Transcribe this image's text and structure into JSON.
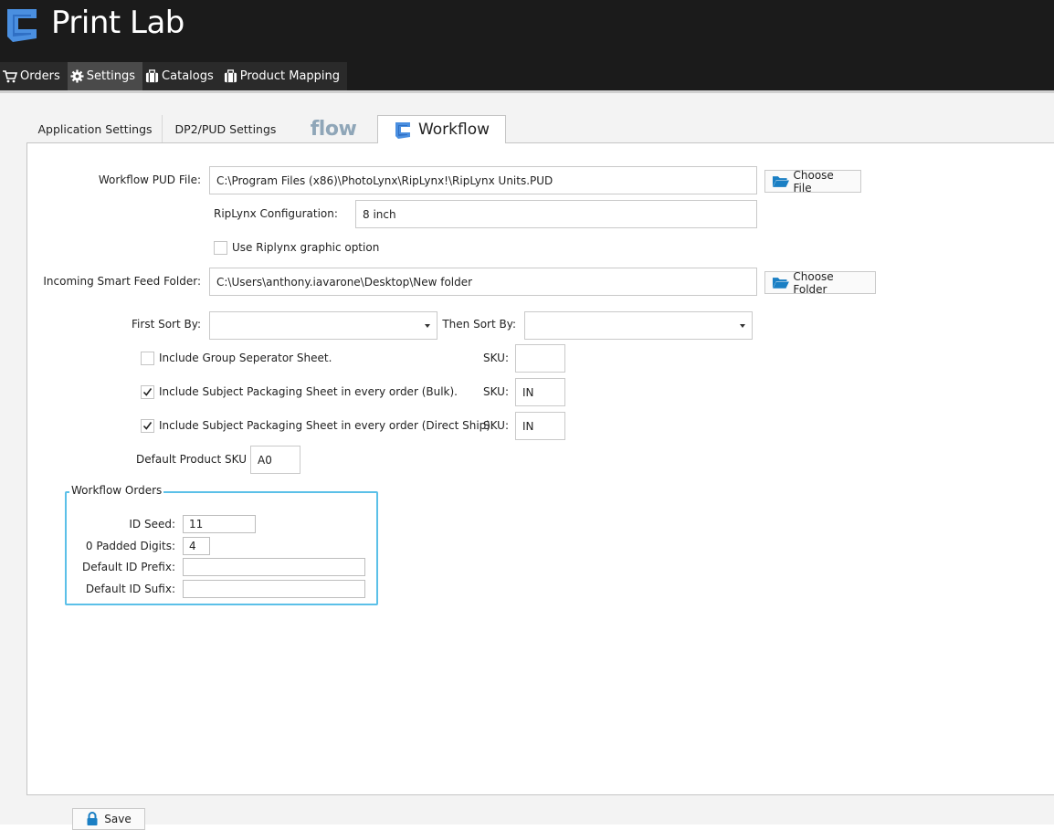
{
  "app": {
    "title": "Print Lab"
  },
  "nav": {
    "items": [
      {
        "label": "Orders",
        "icon": "cart-icon"
      },
      {
        "label": "Settings",
        "icon": "gear-icon",
        "active": true
      },
      {
        "label": "Catalogs",
        "icon": "briefcase-icon"
      },
      {
        "label": "Product Mapping",
        "icon": "briefcase-icon"
      }
    ]
  },
  "tabs": {
    "application_settings": "Application Settings",
    "dp2_pud_settings": "DP2/PUD Settings",
    "flow": "flow",
    "workflow": "Workflow"
  },
  "form": {
    "workflow_pud_file": {
      "label": "Workflow PUD File:",
      "value": "C:\\Program Files (x86)\\PhotoLynx\\RipLynx!\\RipLynx Units.PUD"
    },
    "choose_file": "Choose File",
    "riplynx_config": {
      "label": "RipLynx Configuration:",
      "value": "8 inch"
    },
    "use_riplynx_graphic": {
      "label": "Use Riplynx graphic option",
      "checked": false
    },
    "incoming_folder": {
      "label": "Incoming Smart Feed Folder:",
      "value": "C:\\Users\\anthony.iavarone\\Desktop\\New folder"
    },
    "choose_folder": "Choose Folder",
    "first_sort": {
      "label": "First Sort By:",
      "value": ""
    },
    "then_sort": {
      "label": "Then Sort By:",
      "value": ""
    },
    "include_group_sep": {
      "label": "Include Group Seperator Sheet.",
      "checked": false,
      "sku_label": "SKU:",
      "sku": ""
    },
    "include_bulk": {
      "label": "Include Subject Packaging Sheet in every order (Bulk).",
      "checked": true,
      "sku_label": "SKU:",
      "sku": "IN"
    },
    "include_direct": {
      "label": "Include Subject Packaging Sheet in every order (Direct Ship).",
      "checked": true,
      "sku_label": "SKU:",
      "sku": "IN"
    },
    "default_product_sku": {
      "label": "Default Product SKU",
      "value": "A0"
    }
  },
  "workflow_orders": {
    "legend": "Workflow Orders",
    "id_seed": {
      "label": "ID Seed:",
      "value": "11"
    },
    "padded_digits": {
      "label": "0 Padded Digits:",
      "value": "4"
    },
    "id_prefix": {
      "label": "Default ID Prefix:",
      "value": ""
    },
    "id_sufix": {
      "label": "Default ID Sufix:",
      "value": ""
    }
  },
  "save": {
    "label": "Save"
  },
  "colors": {
    "brand_blue": "#4a8fe0",
    "header_bg": "#1b1b1b",
    "group_border": "#5bc0e8",
    "folder_blue": "#1a7fc4"
  }
}
